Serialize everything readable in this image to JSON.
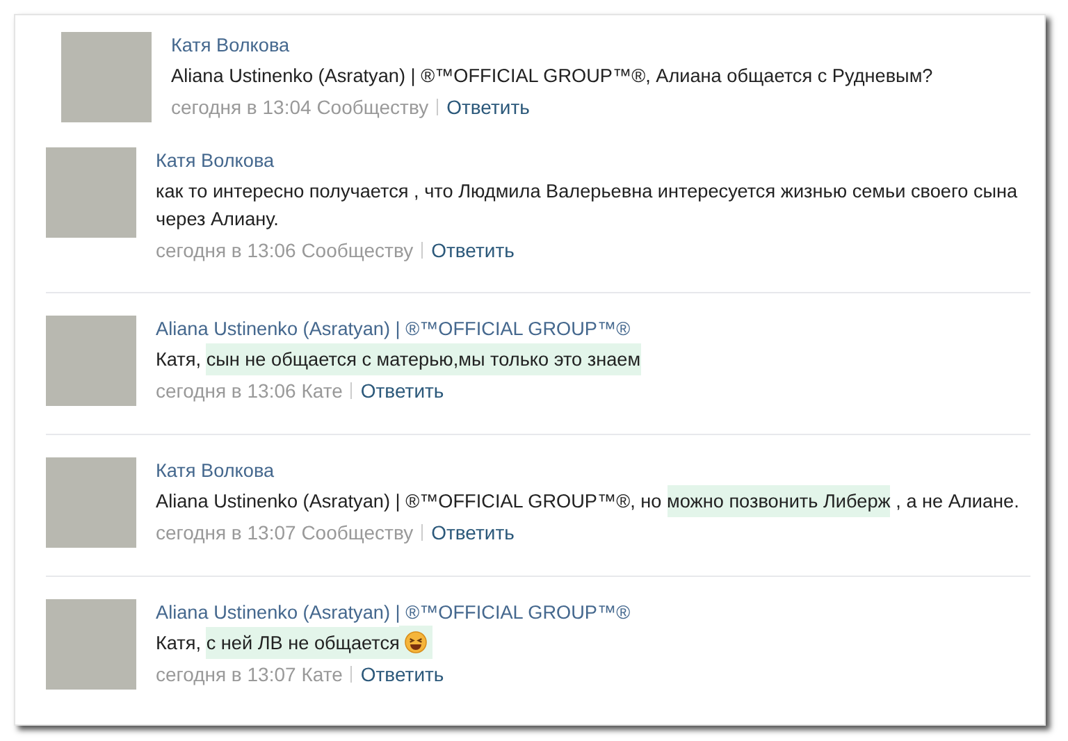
{
  "comments": [
    {
      "author": "Катя Волкова",
      "indented": true,
      "segments": [
        {
          "kind": "text",
          "text": "Aliana Ustinenko (Asratyan) | ®™OFFICIAL GROUP™®, Алиана общается с Рудневым?",
          "highlighted": false
        }
      ],
      "time": "сегодня в 13:04",
      "recipient": "Сообществу",
      "reply": "Ответить"
    },
    {
      "author": "Катя Волкова",
      "indented": false,
      "segments": [
        {
          "kind": "text",
          "text": "как то интересно получается , что Людмила Валерьевна интересуется жизнью семьи своего сына через Алиану.",
          "highlighted": false
        }
      ],
      "time": "сегодня в 13:06",
      "recipient": "Сообществу",
      "reply": "Ответить"
    },
    {
      "author": "Aliana Ustinenko (Asratyan) | ®™OFFICIAL GROUP™®",
      "indented": false,
      "segments": [
        {
          "kind": "text",
          "text": "Катя, ",
          "highlighted": false
        },
        {
          "kind": "text",
          "text": "сын не общается с матерью,мы только это знаем",
          "highlighted": true
        }
      ],
      "time": "сегодня в 13:06",
      "recipient": "Кате",
      "reply": "Ответить"
    },
    {
      "author": "Катя Волкова",
      "indented": false,
      "segments": [
        {
          "kind": "text",
          "text": "Aliana Ustinenko (Asratyan) | ®™OFFICIAL GROUP™®, но ",
          "highlighted": false
        },
        {
          "kind": "text",
          "text": "можно позвонить Либерж",
          "highlighted": true
        },
        {
          "kind": "text",
          "text": " , а не Алиане.",
          "highlighted": false
        }
      ],
      "time": "сегодня в 13:07",
      "recipient": "Сообществу",
      "reply": "Ответить"
    },
    {
      "author": "Aliana Ustinenko (Asratyan) | ®™OFFICIAL GROUP™®",
      "indented": false,
      "segments": [
        {
          "kind": "text",
          "text": "Катя, ",
          "highlighted": false
        },
        {
          "kind": "text",
          "text": "с ней ЛВ не общается",
          "highlighted": true
        },
        {
          "kind": "emoji",
          "highlighted": true
        }
      ],
      "time": "сегодня в 13:07",
      "recipient": "Кате",
      "reply": "Ответить"
    }
  ]
}
